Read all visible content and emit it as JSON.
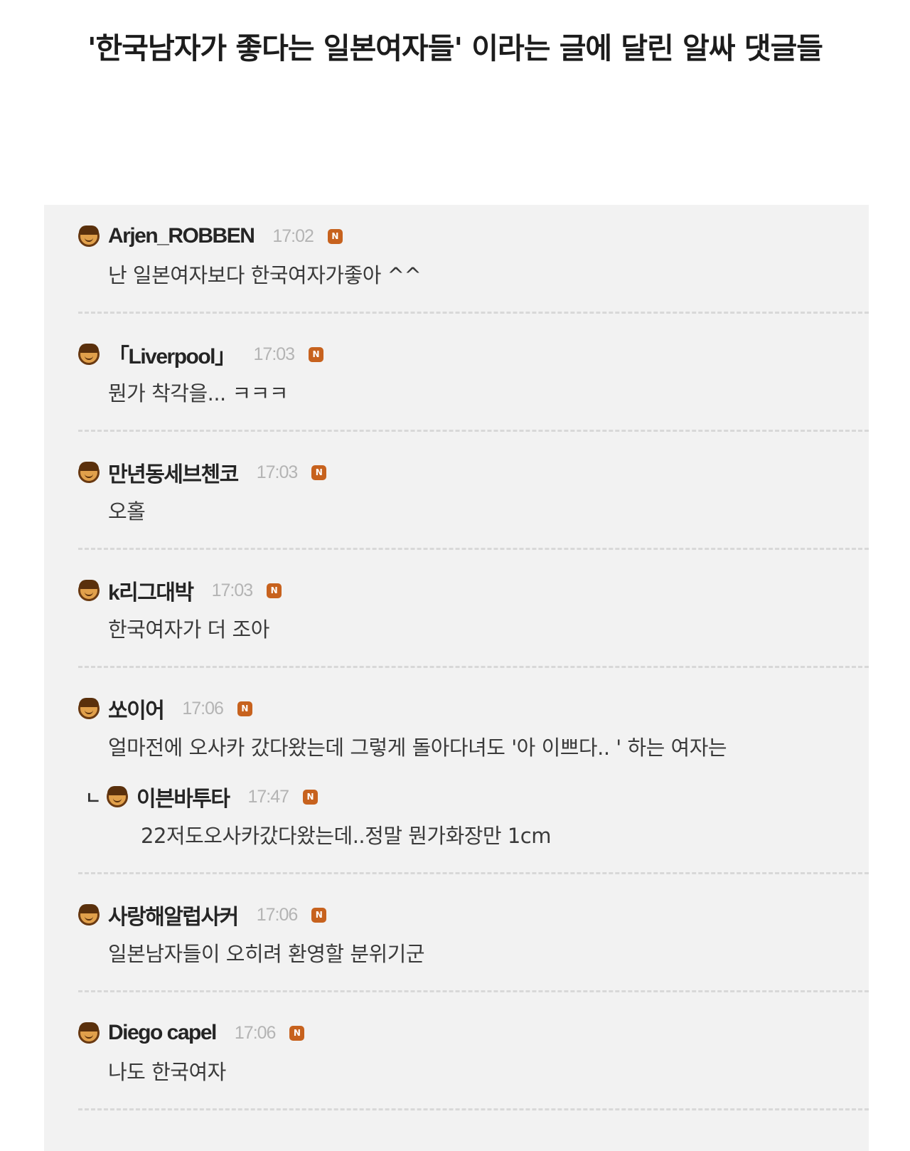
{
  "page": {
    "title": "'한국남자가 좋다는 일본여자들' 이라는 글에 달린 알싸 댓글들"
  },
  "comments": [
    {
      "nick": "Arjen_ROBBEN",
      "time": "17:02",
      "badge": "N",
      "text": "난 일본여자보다 한국여자가좋아 ^^"
    },
    {
      "nick": "「Liverpool」",
      "time": "17:03",
      "badge": "N",
      "text": "뭔가 착각을... ㅋㅋㅋ"
    },
    {
      "nick": "만년동세브첸코",
      "time": "17:03",
      "badge": "N",
      "text": "오홀"
    },
    {
      "nick": "k리그대박",
      "time": "17:03",
      "badge": "N",
      "text": "한국여자가 더 조아"
    },
    {
      "nick": "쏘이어",
      "time": "17:06",
      "badge": "N",
      "text": "얼마전에 오사카 갔다왔는데 그렇게 돌아다녀도 '아 이쁘다.. ' 하는 여자는"
    },
    {
      "nick": "사랑해알럽사커",
      "time": "17:06",
      "badge": "N",
      "text": "일본남자들이 오히려 환영할 분위기군"
    },
    {
      "nick": "Diego capel",
      "time": "17:06",
      "badge": "N",
      "text": "나도 한국여자"
    }
  ],
  "reply": {
    "arrow": "ㄴ",
    "nick": "이븐바투타",
    "time": "17:47",
    "badge": "N",
    "text": "22저도오사카갔다왔는데..정말 뭔가화장만 1cm"
  }
}
